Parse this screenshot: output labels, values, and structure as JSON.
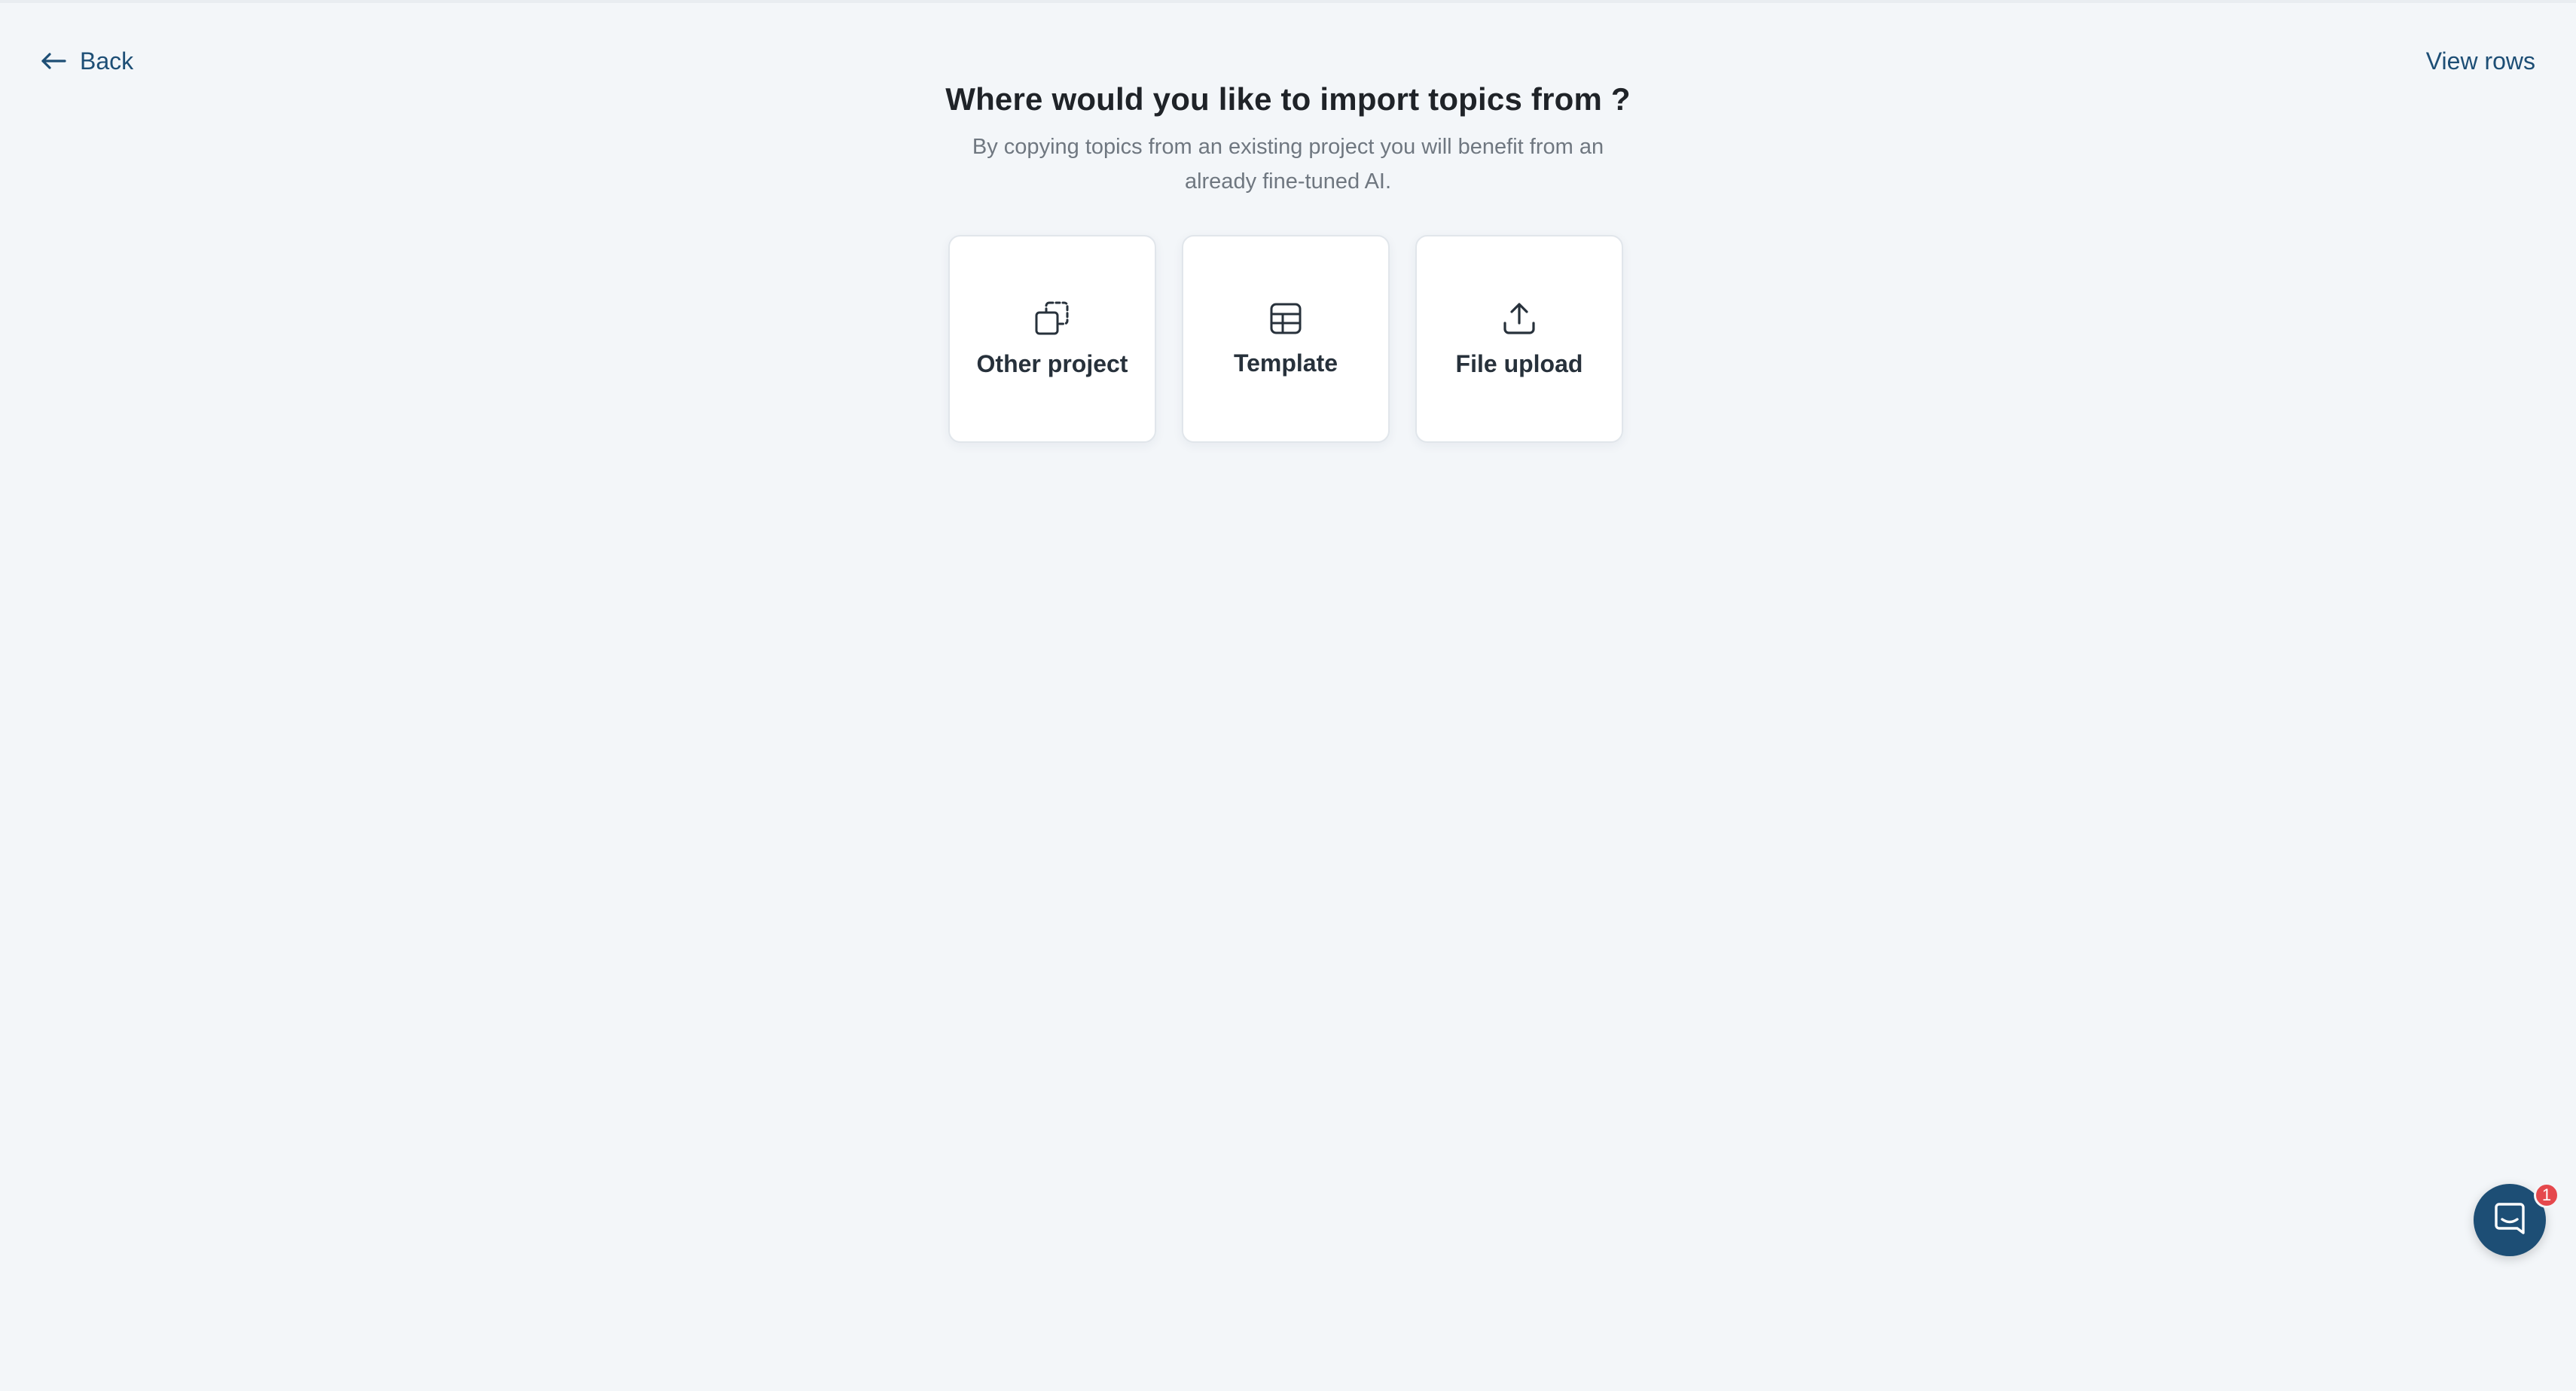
{
  "nav": {
    "back_label": "Back",
    "view_rows_label": "View rows"
  },
  "main": {
    "heading": "Where would you like to import topics from ?",
    "subtitle": "By copying topics from an existing project you will benefit from an already fine-tuned AI.",
    "options": [
      {
        "label": "Other project",
        "icon": "copy-icon"
      },
      {
        "label": "Template",
        "icon": "table-icon"
      },
      {
        "label": "File upload",
        "icon": "upload-icon"
      }
    ]
  },
  "chat": {
    "icon": "chat-icon",
    "badge_count": "1"
  },
  "colors": {
    "background": "#f3f6f9",
    "accent": "#1d4e75",
    "badge": "#e5484d"
  }
}
